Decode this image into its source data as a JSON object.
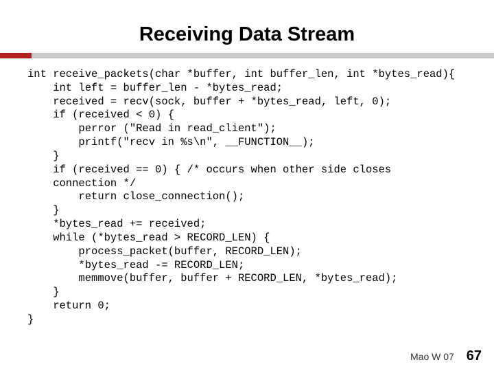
{
  "slide": {
    "title": "Receiving Data Stream",
    "code": "int receive_packets(char *buffer, int buffer_len, int *bytes_read){\n    int left = buffer_len - *bytes_read;\n    received = recv(sock, buffer + *bytes_read, left, 0);\n    if (received < 0) {\n        perror (\"Read in read_client\");\n        printf(\"recv in %s\\n\", __FUNCTION__);\n    }\n    if (received == 0) { /* occurs when other side closes\n    connection */\n        return close_connection();\n    }\n    *bytes_read += received;\n    while (*bytes_read > RECORD_LEN) {\n        process_packet(buffer, RECORD_LEN);\n        *bytes_read -= RECORD_LEN;\n        memmove(buffer, buffer + RECORD_LEN, *bytes_read);\n    }\n    return 0;\n}",
    "footer_text": "Mao W 07",
    "page_number": "67"
  }
}
